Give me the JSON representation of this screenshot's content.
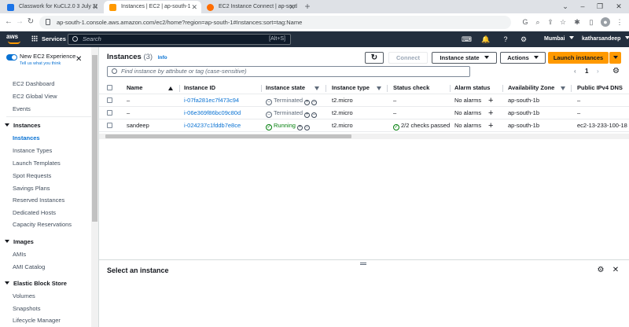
{
  "browser": {
    "tabs": [
      {
        "title": "Classwork for KuCL2.0 3 July 20...",
        "active": false,
        "fav_color": "#1a73e8"
      },
      {
        "title": "Instances | EC2 | ap-south-1",
        "active": true,
        "fav_color": "#ff9900"
      },
      {
        "title": "EC2 Instance Connect | ap-south...",
        "active": false,
        "fav_color": "#ff6d00"
      }
    ],
    "url": "ap-south-1.console.aws.amazon.com/ec2/home?region=ap-south-1#Instances:sort=tag:Name"
  },
  "awsnav": {
    "logo": "aws",
    "services": "Services",
    "search_placeholder": "Search",
    "search_shortcut": "[Alt+S]",
    "region": "Mumbai",
    "account": "katharsandeep"
  },
  "sidebar": {
    "toggle_title": "New EC2 Experience",
    "toggle_sub": "Tell us what you think",
    "top_items": [
      "EC2 Dashboard",
      "EC2 Global View",
      "Events"
    ],
    "sections": [
      {
        "title": "Instances",
        "items": [
          "Instances",
          "Instance Types",
          "Launch Templates",
          "Spot Requests",
          "Savings Plans",
          "Reserved Instances",
          "Dedicated Hosts",
          "Capacity Reservations"
        ]
      },
      {
        "title": "Images",
        "items": [
          "AMIs",
          "AMI Catalog"
        ]
      },
      {
        "title": "Elastic Block Store",
        "items": [
          "Volumes",
          "Snapshots",
          "Lifecycle Manager"
        ]
      }
    ],
    "active_item": "Instances"
  },
  "main": {
    "title": "Instances",
    "count": "(3)",
    "info": "Info",
    "buttons": {
      "connect": "Connect",
      "instance_state": "Instance state",
      "actions": "Actions",
      "launch": "Launch instances"
    },
    "filter_placeholder": "Find instance by attribute or tag (case-sensitive)",
    "page": "1",
    "columns": [
      "Name",
      "Instance ID",
      "Instance state",
      "Instance type",
      "Status check",
      "Alarm status",
      "Availability Zone",
      "Public IPv4 DNS"
    ],
    "rows": [
      {
        "name": "–",
        "id": "i-07fa281ec7f473c94",
        "state": "Terminated",
        "type": "t2.micro",
        "status": "–",
        "alarm": "No alarms",
        "az": "ap-south-1b",
        "dns": "–"
      },
      {
        "name": "–",
        "id": "i-06e369f86bc09c80d",
        "state": "Terminated",
        "type": "t2.micro",
        "status": "–",
        "alarm": "No alarms",
        "az": "ap-south-1b",
        "dns": "–"
      },
      {
        "name": "sandeep",
        "id": "i-024237c1fddb7e8ce",
        "state": "Running",
        "type": "t2.micro",
        "status": "2/2 checks passed",
        "alarm": "No alarms",
        "az": "ap-south-1b",
        "dns": "ec2-13-233-100-18"
      }
    ],
    "split_title": "Select an instance"
  },
  "colors": {
    "aws_nav": "#232f3e",
    "link": "#0972d3",
    "primary": "#ff9900",
    "running": "#037f0c",
    "terminated": "#5f6b7a"
  }
}
